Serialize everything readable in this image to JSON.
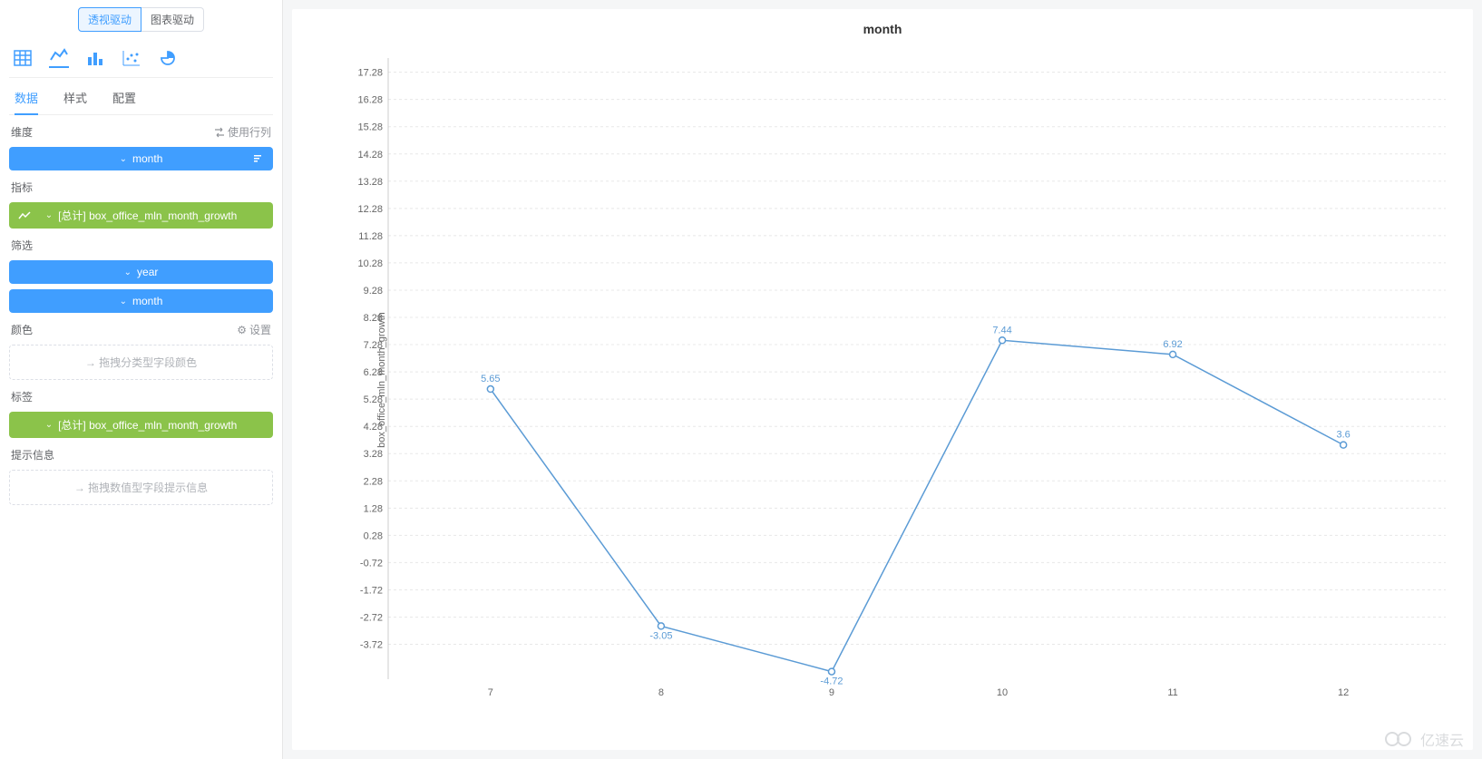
{
  "top_toggle": {
    "active_label": "透视驱动",
    "inactive_label": "图表驱动"
  },
  "chart_type_icons": [
    "table",
    "line",
    "bar",
    "scatter",
    "pie"
  ],
  "config_tabs": {
    "data": "数据",
    "style": "样式",
    "config": "配置"
  },
  "sections": {
    "dimension": {
      "title": "维度",
      "action": "使用行列"
    },
    "metric": {
      "title": "指标"
    },
    "filter": {
      "title": "筛选"
    },
    "color": {
      "title": "颜色",
      "action": "设置",
      "placeholder": "拖拽分类型字段颜色"
    },
    "label": {
      "title": "标签"
    },
    "tooltip": {
      "title": "提示信息",
      "placeholder": "拖拽数值型字段提示信息"
    }
  },
  "pills": {
    "dimension_month": "month",
    "metric_total": "[总计] box_office_mln_month_growth",
    "filter_year": "year",
    "filter_month": "month",
    "label_total": "[总计] box_office_mln_month_growth"
  },
  "chart_data": {
    "type": "line",
    "title": "month",
    "ylabel": "box_office_mln_month_growth",
    "x": [
      7,
      8,
      9,
      10,
      11,
      12
    ],
    "values": [
      5.65,
      -3.05,
      -4.72,
      7.44,
      6.92,
      3.6
    ],
    "data_labels": [
      "5.65",
      "-3.05",
      "-4.72",
      "7.44",
      "6.92",
      "3.6"
    ],
    "y_ticks": [
      -3.72,
      -2.72,
      -1.72,
      -0.72,
      0.28,
      1.28,
      2.28,
      3.28,
      4.28,
      5.28,
      6.28,
      7.28,
      8.28,
      9.28,
      10.28,
      11.28,
      12.28,
      13.28,
      14.28,
      15.28,
      16.28,
      17.28
    ],
    "ylim": [
      -5,
      17.8
    ]
  },
  "watermark": "亿速云"
}
